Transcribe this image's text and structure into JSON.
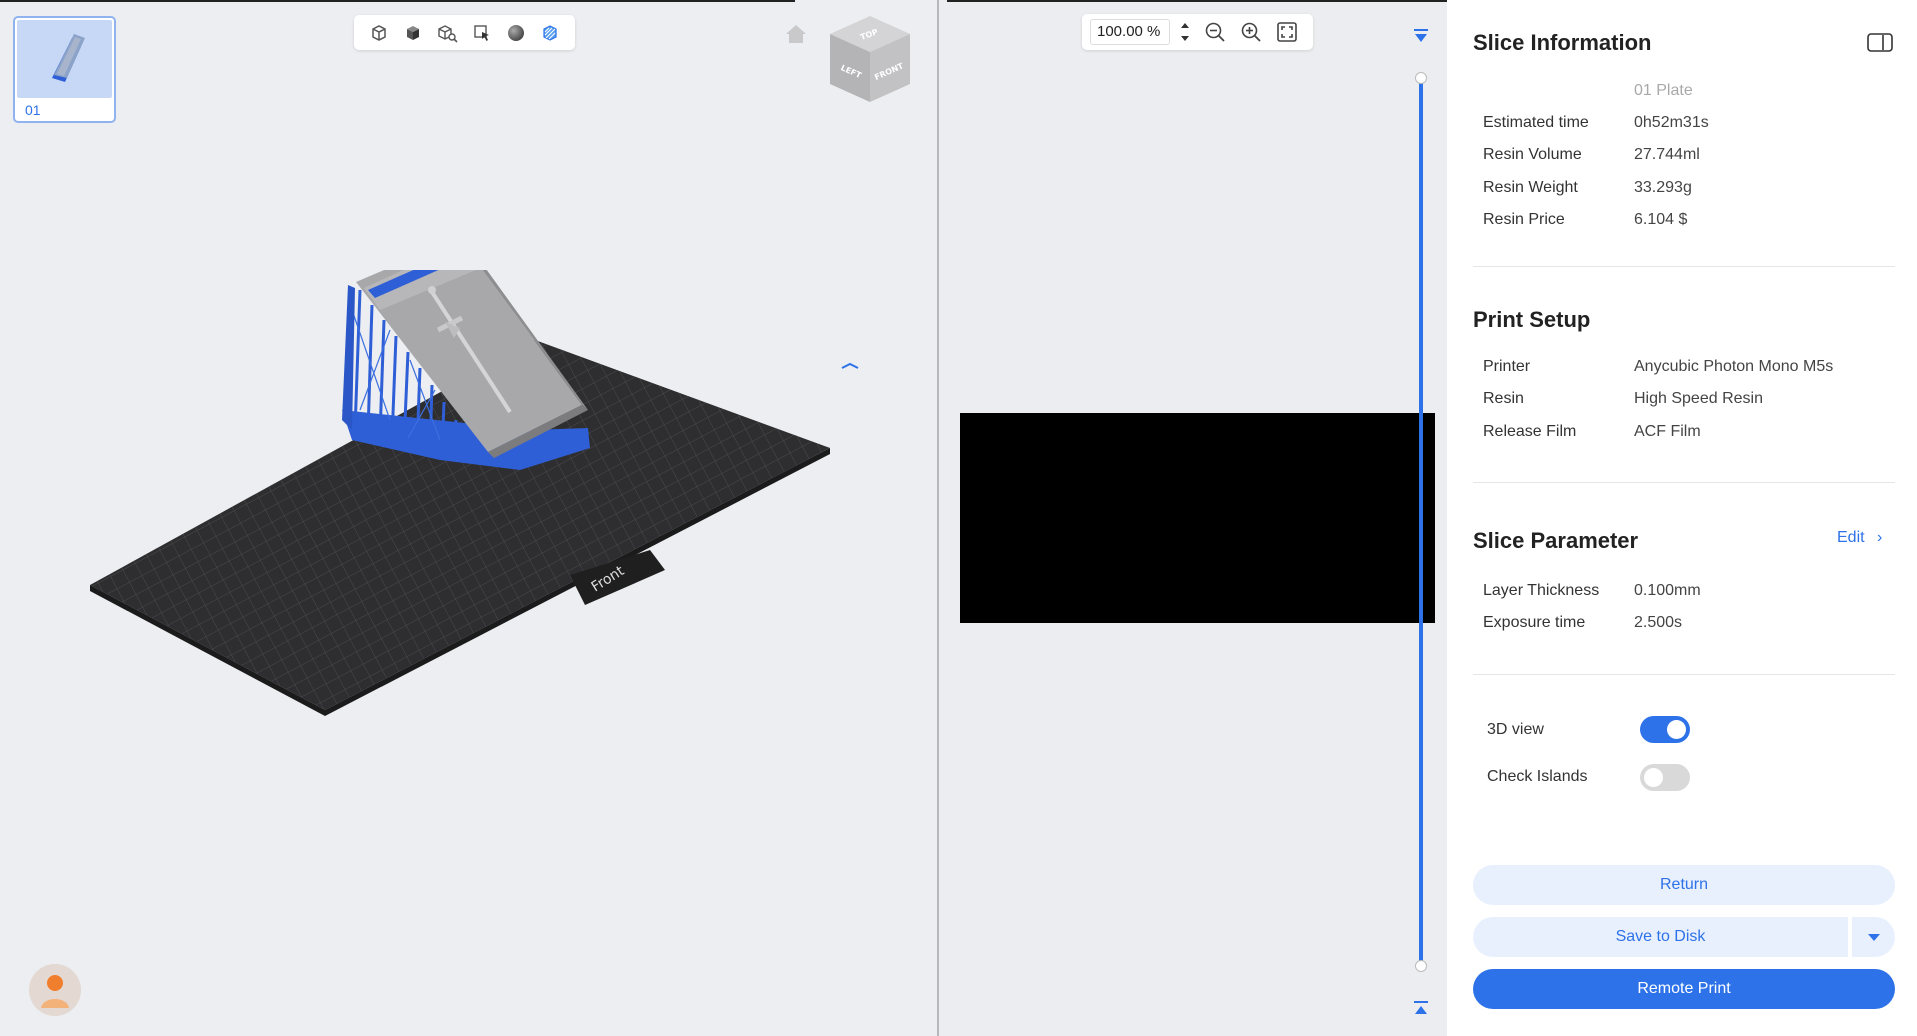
{
  "plates": [
    {
      "label": "01"
    }
  ],
  "toolbar3d": {
    "icons": [
      "wireframe-box-icon",
      "solid-box-icon",
      "box-search-icon",
      "select-cursor-icon",
      "sphere-icon",
      "striped-box-icon"
    ]
  },
  "view_cube": {
    "top": "TOP",
    "left": "LEFT",
    "front": "FRONT"
  },
  "build_plate": {
    "front_label": "Front"
  },
  "layer_view": {
    "zoom_value": "100.00 %"
  },
  "slice_info": {
    "title": "Slice Information",
    "plate_name": "01 Plate",
    "rows": [
      {
        "label": "Estimated time",
        "value": "0h52m31s"
      },
      {
        "label": "Resin Volume",
        "value": "27.744ml"
      },
      {
        "label": "Resin Weight",
        "value": "33.293g"
      },
      {
        "label": "Resin Price",
        "value": "6.104 $"
      }
    ]
  },
  "print_setup": {
    "title": "Print Setup",
    "rows": [
      {
        "label": "Printer",
        "value": "Anycubic Photon Mono M5s"
      },
      {
        "label": "Resin",
        "value": "High Speed Resin"
      },
      {
        "label": "Release Film",
        "value": "ACF Film"
      }
    ]
  },
  "slice_parameter": {
    "title": "Slice Parameter",
    "edit_label": "Edit",
    "rows": [
      {
        "label": "Layer Thickness",
        "value": "0.100mm"
      },
      {
        "label": "Exposure time",
        "value": "2.500s"
      }
    ]
  },
  "toggles": [
    {
      "label": "3D view",
      "on": true
    },
    {
      "label": "Check Islands",
      "on": false
    }
  ],
  "buttons": {
    "return": "Return",
    "save": "Save to Disk",
    "remote": "Remote Print"
  },
  "colors": {
    "accent": "#2d72e8",
    "support_blue": "#2f5fd6",
    "plate": "#2e2e30",
    "model_grey": "#a8a8aa"
  }
}
